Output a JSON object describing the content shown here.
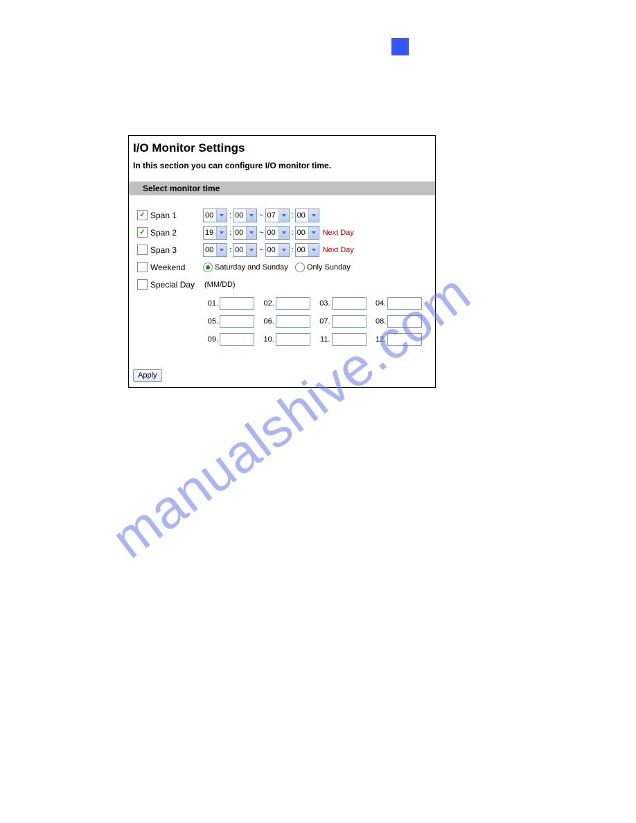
{
  "watermark": "manualshive.com",
  "panel": {
    "title": "I/O Monitor Settings",
    "description": "In this section you can configure I/O monitor time.",
    "section_header": "Select monitor time"
  },
  "spans": [
    {
      "label": "Span 1",
      "checked": true,
      "h1": "00",
      "m1": "00",
      "h2": "07",
      "m2": "00",
      "next_day": ""
    },
    {
      "label": "Span 2",
      "checked": true,
      "h1": "19",
      "m1": "00",
      "h2": "00",
      "m2": "00",
      "next_day": "Next Day"
    },
    {
      "label": "Span 3",
      "checked": false,
      "h1": "00",
      "m1": "00",
      "h2": "00",
      "m2": "00",
      "next_day": "Next Day"
    }
  ],
  "weekend": {
    "label": "Weekend",
    "option1": "Saturday and Sunday",
    "option2": "Only Sunday",
    "selected": "option1"
  },
  "special_day": {
    "label": "Special Day",
    "hint": "(MM/DD)",
    "items": [
      "01.",
      "02.",
      "03.",
      "04.",
      "05.",
      "06.",
      "07.",
      "08.",
      "09.",
      "10.",
      "11.",
      "12."
    ]
  },
  "apply_label": "Apply",
  "sep_tilde": "~",
  "sep_colon": ":",
  "check_glyph": "✓"
}
